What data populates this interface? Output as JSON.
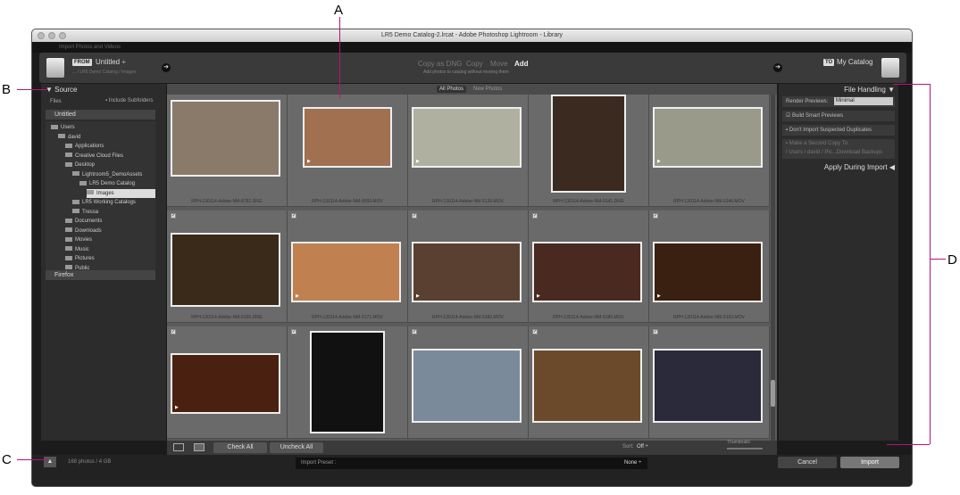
{
  "callouts": {
    "a": "A",
    "b": "B",
    "c": "C",
    "d": "D"
  },
  "window": {
    "title": "LR5 Demo Catalog-2.lrcat - Adobe Photoshop Lightroom - Library",
    "import_menu": "Import Photos and Videos"
  },
  "source": {
    "from_tag": "FROM",
    "name": "Untitled ÷",
    "path": "... / LR5 Demo Catalog / Images"
  },
  "modes": {
    "copy_dng": "Copy as DNG",
    "copy": "Copy",
    "move": "Move",
    "add": "Add",
    "desc": "Add photos to catalog without moving them"
  },
  "destination": {
    "to_tag": "TO",
    "name": "My Catalog"
  },
  "left_panel": {
    "header": "Source",
    "files_label": "Files",
    "include_subfolders": "Include Subfolders",
    "untitled": "Untitled",
    "tree": [
      {
        "label": "Users",
        "indent": 0
      },
      {
        "label": "david",
        "indent": 1
      },
      {
        "label": "Applications",
        "indent": 2
      },
      {
        "label": "Creative Cloud Files",
        "indent": 2
      },
      {
        "label": "Desktop",
        "indent": 2
      },
      {
        "label": "Lightroom5_DemoAssets",
        "indent": 3
      },
      {
        "label": "LR5 Demo Catalog",
        "indent": 4
      },
      {
        "label": "Images",
        "indent": 5
      },
      {
        "label": "LR5 Working Catalogs",
        "indent": 3
      },
      {
        "label": "Tressa",
        "indent": 3
      },
      {
        "label": "Documents",
        "indent": 2
      },
      {
        "label": "Downloads",
        "indent": 2
      },
      {
        "label": "Movies",
        "indent": 2
      },
      {
        "label": "Music",
        "indent": 2
      },
      {
        "label": "Pictures",
        "indent": 2
      },
      {
        "label": "Public",
        "indent": 2
      }
    ],
    "firefox": "Firefox"
  },
  "grid": {
    "tab_all": "All Photos",
    "tab_new": "New Photos",
    "files": [
      "RPH-130114-Adobe-NM-8762.DNG",
      "RPH-130114-Adobe-NM-9093.MOV",
      "RPH-130114-Adobe-NM-9139.MOV",
      "RPH-130114-Adobe-NM-9141.DNG",
      "RPH-130114-Adobe-NM-9146.MOV",
      "RPH-130114-Adobe-NM-9165.DNG",
      "RPH-130114-Adobe-NM-9171.MOV",
      "RPH-130114-Adobe-NM-9180.MOV",
      "RPH-130114-Adobe-NM-9185.MOV",
      "RPH-130114-Adobe-NM-9193.MOV",
      "",
      "",
      "",
      "",
      ""
    ],
    "thumb_colors": [
      "#8a7a6a",
      "#a07050",
      "#b0b0a0",
      "#3a2a20",
      "#9a9a8a",
      "#3a2a1a",
      "#c08050",
      "#5a4030",
      "#4a2a20",
      "#3a2010",
      "#4a2010",
      "#111111",
      "#7a8a9a",
      "#6a4a2a",
      "#2a2a3a"
    ],
    "video_label": "▶"
  },
  "grid_toolbar": {
    "check_all": "Check All",
    "uncheck_all": "Uncheck All",
    "sort_label": "Sort:",
    "sort_value": "Off ÷",
    "thumbnails": "Thumbnails"
  },
  "right_panel": {
    "header": "File Handling",
    "render_label": "Render Previews:",
    "render_value": "Minimal",
    "smart_previews": "Build Smart Previews",
    "no_duplicates": "Don't Import Suspected Duplicates",
    "second_copy": "Make a Second Copy To:",
    "second_copy_path": "/ Users / david / Pic...Download Backups",
    "apply_during": "Apply During Import"
  },
  "bottom": {
    "count": "168 photos / 4 GB",
    "preset_label": "Import Preset :",
    "preset_value": "None ÷",
    "cancel": "Cancel",
    "import": "Import"
  }
}
